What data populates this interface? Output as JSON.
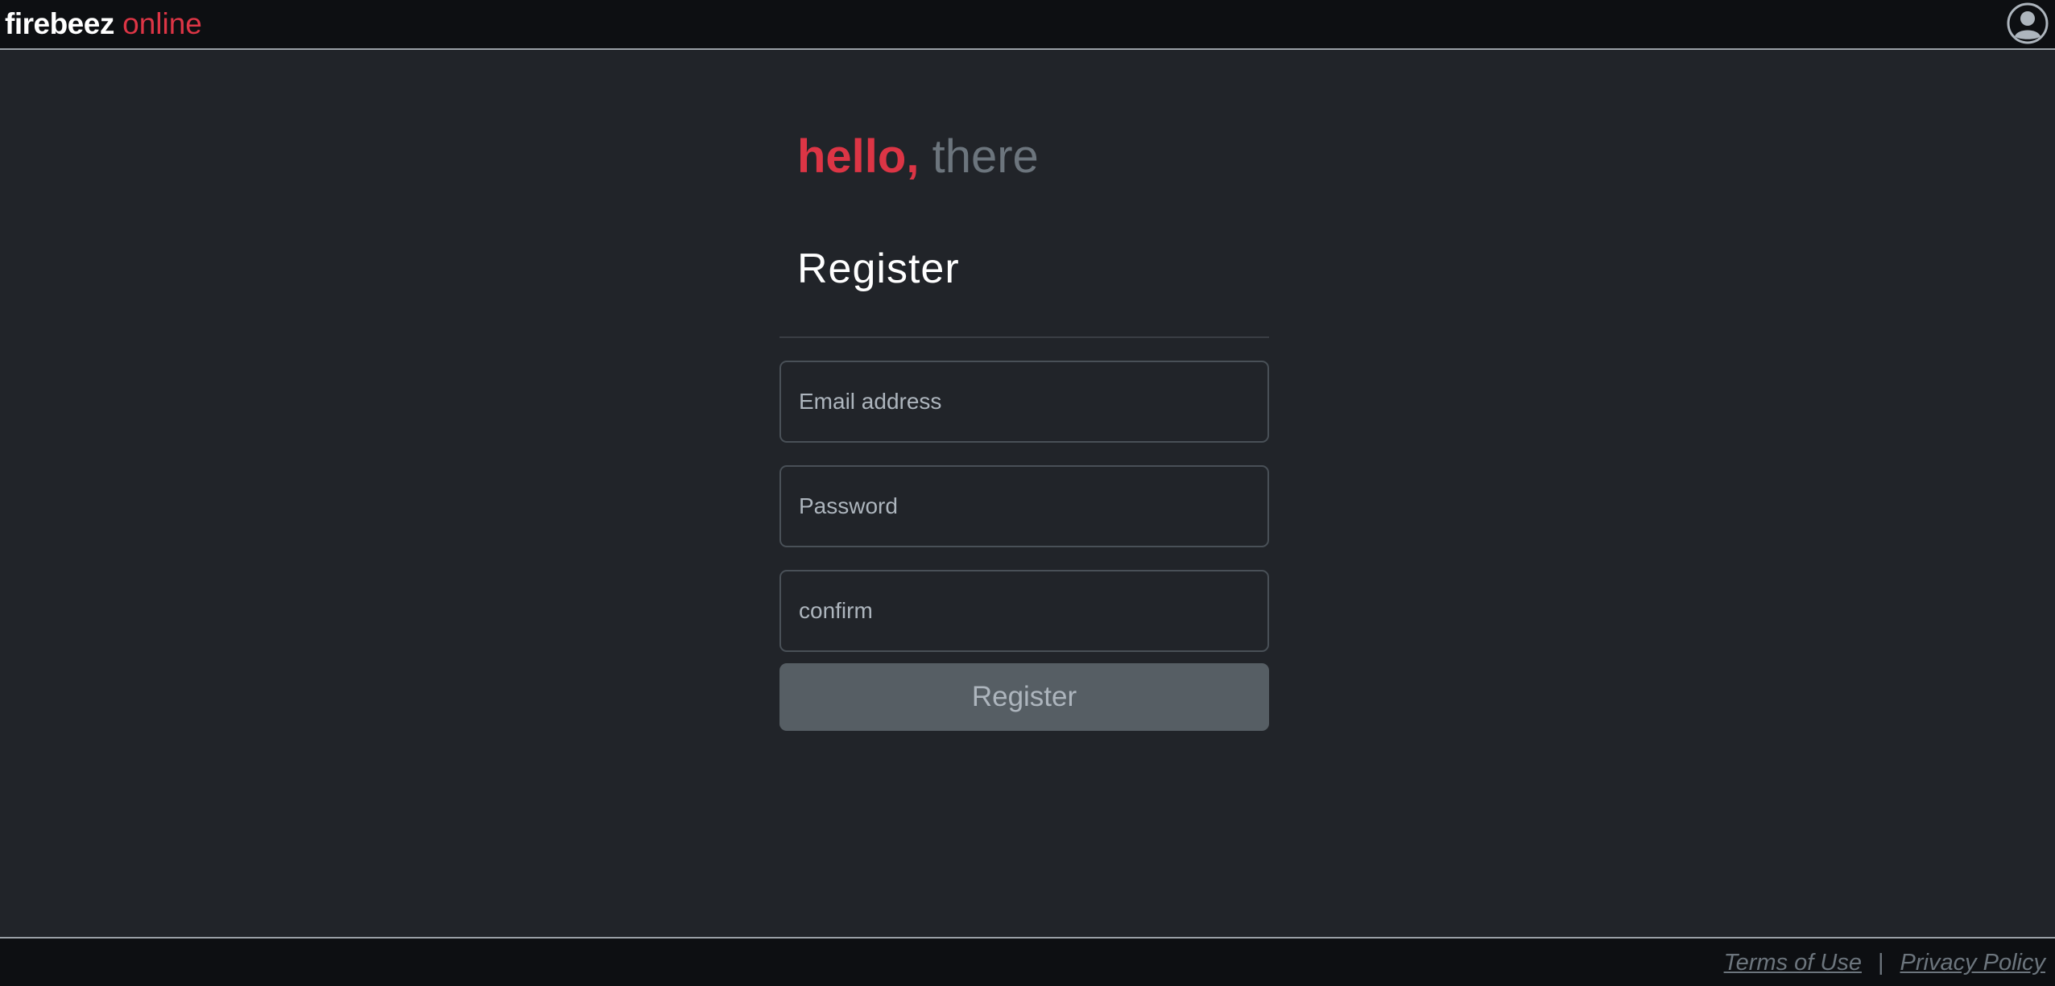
{
  "header": {
    "brand_main": "firebeez",
    "brand_accent": "online",
    "profile_icon": "user-circle-icon"
  },
  "main": {
    "greeting_strong": "hello,",
    "greeting_light": "there",
    "form_title": "Register",
    "email_placeholder": "Email address",
    "email_value": "",
    "password_placeholder": "Password",
    "password_value": "",
    "confirm_placeholder": "confirm",
    "confirm_value": "",
    "submit_label": "Register"
  },
  "footer": {
    "terms_label": "Terms of Use",
    "separator": "|",
    "privacy_label": "Privacy Policy"
  },
  "colors": {
    "background": "#212429",
    "bar_background": "#0d0f12",
    "accent": "#dc3545",
    "muted": "#6c757d",
    "button": "#565e64"
  }
}
